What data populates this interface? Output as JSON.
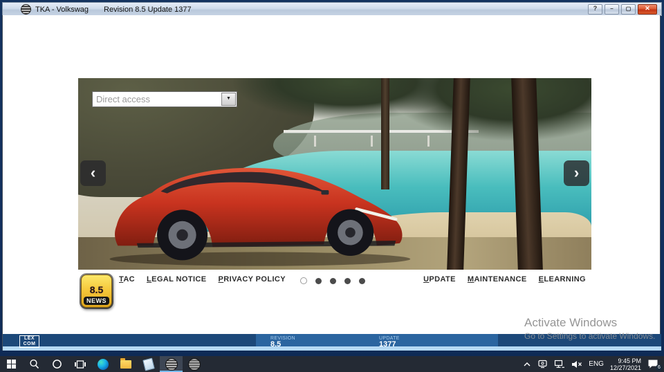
{
  "window": {
    "title_left": "TKA - Volkswag",
    "title_right": "Revision 8.5 Update 1377",
    "help_glyph": "?",
    "minimize_glyph": "—",
    "maximize_glyph": "▢",
    "close_glyph": "✕"
  },
  "banner": {
    "direct_access_value": "Direct access",
    "combo_arrow": "▼",
    "prev_glyph": "‹",
    "next_glyph": "›",
    "dots_total": 5,
    "dots_active_index": 0
  },
  "links_left": [
    {
      "label": "TAC"
    },
    {
      "label": "LEGAL NOTICE"
    },
    {
      "label": "PRIVACY POLICY"
    }
  ],
  "links_right": [
    {
      "label": "UPDATE"
    },
    {
      "label": "MAINTENANCE"
    },
    {
      "label": "ELEARNING"
    }
  ],
  "news_badge": {
    "version": "8.5",
    "word": "NEWS"
  },
  "status_bar": {
    "logo_top": "LEX",
    "logo_bottom": "COM",
    "revision_label": "REVISION",
    "revision_value": "8.5",
    "update_label": "UPDATE",
    "update_value": "1377"
  },
  "watermark": {
    "line1": "Activate Windows",
    "line2": "Go to Settings to activate Windows."
  },
  "tray": {
    "language": "ENG",
    "time": "9:45 PM",
    "date": "12/27/2021",
    "badge": "6"
  },
  "colors": {
    "status_bar": "#1c4879",
    "status_bar_panel": "#2b65a0",
    "status_stripe": "#b5d9f4",
    "taskbar": "#242a34",
    "badge_yellow": "#f6c93c",
    "car_red": "#c8331f",
    "lake_teal": "#49bdbd"
  }
}
